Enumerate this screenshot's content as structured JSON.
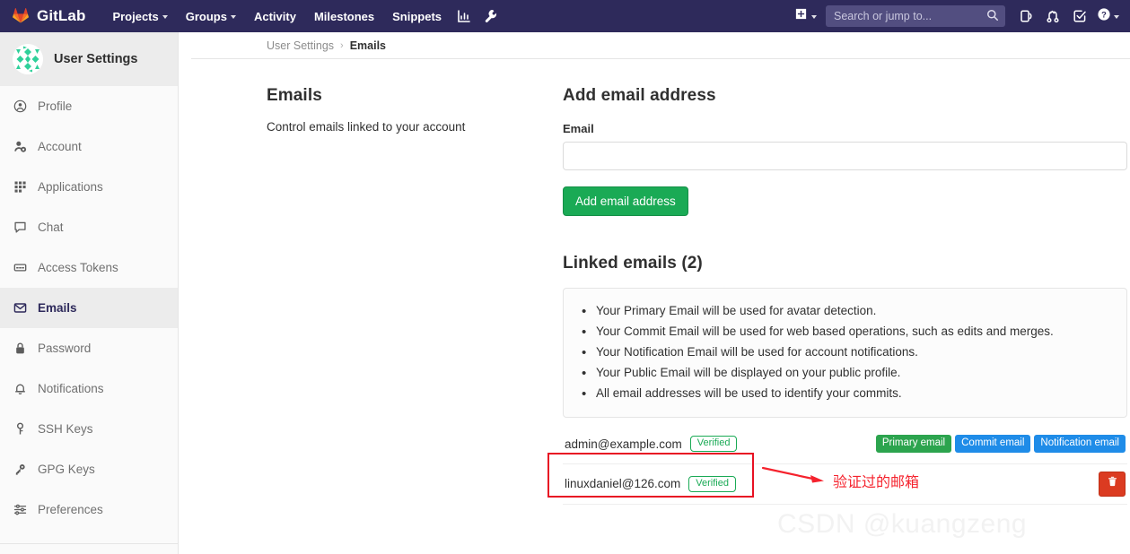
{
  "navbar": {
    "brand": "GitLab",
    "brand_icon": "gitlab-logo-icon",
    "links": [
      {
        "label": "Projects",
        "caret": true
      },
      {
        "label": "Groups",
        "caret": true
      },
      {
        "label": "Activity",
        "caret": false
      },
      {
        "label": "Milestones",
        "caret": false
      },
      {
        "label": "Snippets",
        "caret": false
      }
    ],
    "icon_buttons": [
      {
        "name": "analytics-chart-icon"
      },
      {
        "name": "wrench-admin-icon"
      }
    ],
    "create_new": {
      "name": "plus-square-icon",
      "label": ""
    },
    "search": {
      "placeholder": "Search or jump to...",
      "value": "",
      "icon": "search-icon"
    },
    "right_icons": [
      {
        "name": "issues-icon"
      },
      {
        "name": "merge-requests-icon"
      },
      {
        "name": "todos-checkmark-icon"
      }
    ],
    "help": {
      "name": "help-question-icon",
      "caret": true
    }
  },
  "sidebar": {
    "title": "User Settings",
    "avatar": "user-identicon-avatar",
    "items": [
      {
        "label": "Profile",
        "icon": "profile-user-circle-icon",
        "active": false
      },
      {
        "label": "Account",
        "icon": "account-gear-user-icon",
        "active": false
      },
      {
        "label": "Applications",
        "icon": "applications-grid-icon",
        "active": false
      },
      {
        "label": "Chat",
        "icon": "chat-bubble-icon",
        "active": false
      },
      {
        "label": "Access Tokens",
        "icon": "access-token-card-icon",
        "active": false
      },
      {
        "label": "Emails",
        "icon": "envelope-icon",
        "active": true
      },
      {
        "label": "Password",
        "icon": "lock-icon",
        "active": false
      },
      {
        "label": "Notifications",
        "icon": "bell-icon",
        "active": false
      },
      {
        "label": "SSH Keys",
        "icon": "key-icon",
        "active": false
      },
      {
        "label": "GPG Keys",
        "icon": "gpg-key-icon",
        "active": false
      },
      {
        "label": "Preferences",
        "icon": "sliders-preferences-icon",
        "active": false
      }
    ]
  },
  "breadcrumb": {
    "parent": "User Settings",
    "separator": "›",
    "current": "Emails"
  },
  "main": {
    "section_title": "Emails",
    "section_description": "Control emails linked to your account",
    "add_email": {
      "heading": "Add email address",
      "field_label": "Email",
      "field_value": "",
      "field_placeholder": "",
      "submit_label": "Add email address",
      "submit_color": "#1aaa55"
    },
    "linked": {
      "heading": "Linked emails (2)",
      "notes": [
        "Your Primary Email will be used for avatar detection.",
        "Your Commit Email will be used for web based operations, such as edits and merges.",
        "Your Notification Email will be used for account notifications.",
        "Your Public Email will be displayed on your public profile.",
        "All email addresses will be used to identify your commits."
      ],
      "rows": [
        {
          "address": "admin@example.com",
          "verified_label": "Verified",
          "badges": [
            {
              "label": "Primary email",
              "color": "#2ca44e",
              "style": "green"
            },
            {
              "label": "Commit email",
              "color": "#1f8ce8",
              "style": "blue"
            },
            {
              "label": "Notification email",
              "color": "#1f8ce8",
              "style": "blue"
            }
          ],
          "deletable": false
        },
        {
          "address": "linuxdaniel@126.com",
          "verified_label": "Verified",
          "badges": [],
          "deletable": true,
          "delete_icon": "trash-icon"
        }
      ]
    }
  },
  "annotations": {
    "highlight_box_color": "#e81123",
    "arrow_icon": "red-arrow-icon",
    "arrow_color": "#f5222d",
    "note_text": "验证过的邮箱",
    "watermark": "CSDN @kuangzeng"
  }
}
